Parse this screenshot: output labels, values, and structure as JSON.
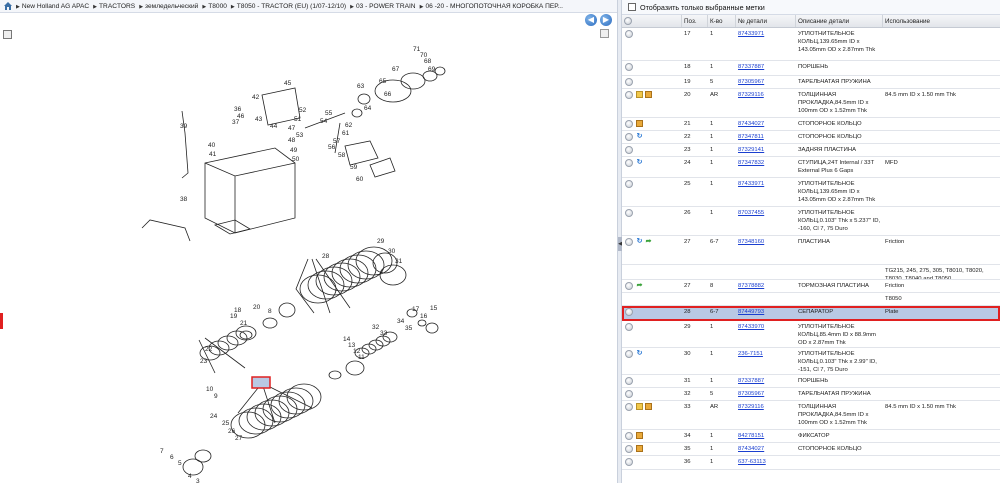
{
  "breadcrumb": [
    "New Holland AG APAC",
    "TRACTORS",
    "земледельческий",
    "T8000",
    "T8050 - TRACTOR (EU) (1/07-12/10)",
    "03 - POWER TRAIN",
    "06 -20 - МНОГОПОТОЧНАЯ КОРОБКА ПЕР..."
  ],
  "filter": {
    "label": "Отобразить только выбранные метки"
  },
  "columns": {
    "pos": "Поз.",
    "qty": "К-во",
    "num": "№ детали",
    "desc": "Описание детали",
    "use": "Использование"
  },
  "diagram_labels": [
    {
      "t": "39"
    },
    {
      "t": "40"
    },
    {
      "t": "41"
    },
    {
      "t": "42"
    },
    {
      "t": "43"
    },
    {
      "t": "44"
    },
    {
      "t": "45"
    },
    {
      "t": "46"
    },
    {
      "t": "47"
    },
    {
      "t": "48"
    },
    {
      "t": "49"
    },
    {
      "t": "50"
    },
    {
      "t": "51"
    },
    {
      "t": "52"
    },
    {
      "t": "53"
    },
    {
      "t": "54"
    },
    {
      "t": "55"
    },
    {
      "t": "56"
    },
    {
      "t": "57"
    },
    {
      "t": "58"
    },
    {
      "t": "59"
    },
    {
      "t": "60"
    },
    {
      "t": "61"
    },
    {
      "t": "62"
    },
    {
      "t": "63"
    },
    {
      "t": "64"
    },
    {
      "t": "65"
    },
    {
      "t": "66"
    },
    {
      "t": "67"
    },
    {
      "t": "68"
    },
    {
      "t": "69"
    },
    {
      "t": "70"
    },
    {
      "t": "71"
    },
    {
      "t": "36"
    },
    {
      "t": "37"
    },
    {
      "t": "38"
    },
    {
      "t": "18"
    },
    {
      "t": "19"
    },
    {
      "t": "20"
    },
    {
      "t": "21"
    },
    {
      "t": "22"
    },
    {
      "t": "23"
    },
    {
      "t": "24"
    },
    {
      "t": "25"
    },
    {
      "t": "26"
    },
    {
      "t": "27"
    },
    {
      "t": "28"
    },
    {
      "t": "29"
    },
    {
      "t": "30"
    },
    {
      "t": "31"
    },
    {
      "t": "32"
    },
    {
      "t": "33"
    },
    {
      "t": "34"
    },
    {
      "t": "35"
    },
    {
      "t": "17"
    },
    {
      "t": "16"
    },
    {
      "t": "15"
    },
    {
      "t": "14"
    },
    {
      "t": "13"
    },
    {
      "t": "12"
    },
    {
      "t": "11"
    },
    {
      "t": "10"
    },
    {
      "t": "9"
    },
    {
      "t": "8"
    },
    {
      "t": "7"
    },
    {
      "t": "6"
    },
    {
      "t": "5"
    },
    {
      "t": "4"
    },
    {
      "t": "3"
    },
    {
      "t": "2"
    },
    {
      "t": "1"
    }
  ],
  "parts": [
    {
      "icons": [
        "radio"
      ],
      "pos": "17",
      "qty": "1",
      "num": "87433971",
      "desc": "УПЛОТНИТЕЛЬНОЕ КОЛЬЦ,139.65mm ID x 143.05mm OD x 2.87mm Thk",
      "use": ""
    },
    {
      "icons": [
        "radio"
      ],
      "pos": "18",
      "qty": "1",
      "num": "87337887",
      "desc": "ПОРШЕНЬ",
      "use": ""
    },
    {
      "icons": [
        "radio"
      ],
      "pos": "19",
      "qty": "5",
      "num": "87305967",
      "desc": "ТАРЕЛЬЧАТАЯ ПРУЖИНА",
      "use": ""
    },
    {
      "icons": [
        "radio",
        "note",
        "box"
      ],
      "pos": "20",
      "qty": "AR",
      "num": "87329116",
      "desc": "ТОЛЩИННАЯ ПРОКЛАДКА,84.5mm ID x 100mm OD x 1.52mm Thk",
      "use": "84.5 mm ID x 1.50 mm Thk"
    },
    {
      "icons": [
        "radio",
        "box"
      ],
      "pos": "21",
      "qty": "1",
      "num": "87434027",
      "desc": "СТОПОРНОЕ КОЛЬЦО",
      "use": ""
    },
    {
      "icons": [
        "radio",
        "arrow"
      ],
      "pos": "22",
      "qty": "1",
      "num": "87347811",
      "desc": "СТОПОРНОЕ КОЛЬЦО",
      "use": ""
    },
    {
      "icons": [
        "radio"
      ],
      "pos": "23",
      "qty": "1",
      "num": "87329141",
      "desc": "ЗАДНЯЯ ПЛАСТИНА",
      "use": ""
    },
    {
      "icons": [
        "radio",
        "arrow"
      ],
      "pos": "24",
      "qty": "1",
      "num": "87347832",
      "desc": "СТУПИЦА,24T Internal / 33T External Plus 6 Gaps",
      "use": "MFD"
    },
    {
      "icons": [
        "radio"
      ],
      "pos": "25",
      "qty": "1",
      "num": "87433971",
      "desc": "УПЛОТНИТЕЛЬНОЕ КОЛЬЦ,139.65mm ID x 143.05mm OD x 2.87mm Thk",
      "use": ""
    },
    {
      "icons": [
        "radio"
      ],
      "pos": "26",
      "qty": "1",
      "num": "87037455",
      "desc": "УПЛОТНИТЕЛЬНОЕ КОЛЬЦ,0.103\" Thk x 5.237\" ID, -160, Cl 7, 75 Duro",
      "use": ""
    },
    {
      "icons": [
        "radio",
        "arrow",
        "green"
      ],
      "pos": "27",
      "qty": "6-7",
      "num": "87348160",
      "desc": "ПЛАСТИНА",
      "use": "Friction"
    },
    {
      "icons": [],
      "pos": "",
      "qty": "",
      "num": "",
      "desc": "",
      "use": "TG215, 245, 275, 305, T8010, T8020, T8030, T8040 and T8050"
    },
    {
      "icons": [
        "radio",
        "green"
      ],
      "pos": "27",
      "qty": "8",
      "num": "87378882",
      "desc": "ТОРМОЗНАЯ ПЛАСТИНА",
      "use": "Friction"
    },
    {
      "icons": [],
      "pos": "",
      "qty": "",
      "num": "",
      "desc": "",
      "use": "T8050"
    },
    {
      "icons": [
        "radio"
      ],
      "pos": "28",
      "qty": "6-7",
      "num": "87449793",
      "desc": "СЕПАРАТОР",
      "use": "Plate",
      "selected": true
    },
    {
      "icons": [
        "radio"
      ],
      "pos": "29",
      "qty": "1",
      "num": "87433970",
      "desc": "УПЛОТНИТЕЛЬНОЕ КОЛЬЦ,85.4mm ID x 88.9mm OD x 2.87mm Thk",
      "use": ""
    },
    {
      "icons": [
        "radio",
        "arrow"
      ],
      "pos": "30",
      "qty": "1",
      "num": "236-7151",
      "desc": "УПЛОТНИТЕЛЬНОЕ КОЛЬЦ,0.103\" Thk x 2.99\" ID, -151, Cl 7, 75 Duro",
      "use": ""
    },
    {
      "icons": [
        "radio"
      ],
      "pos": "31",
      "qty": "1",
      "num": "87337887",
      "desc": "ПОРШЕНЬ",
      "use": ""
    },
    {
      "icons": [
        "radio"
      ],
      "pos": "32",
      "qty": "5",
      "num": "87305967",
      "desc": "ТАРЕЛЬЧАТАЯ ПРУЖИНА",
      "use": ""
    },
    {
      "icons": [
        "radio",
        "note",
        "box"
      ],
      "pos": "33",
      "qty": "AR",
      "num": "87329116",
      "desc": "ТОЛЩИННАЯ ПРОКЛАДКА,84.5mm ID x 100mm OD x 1.52mm Thk",
      "use": "84.5 mm ID x 1.50 mm Thk"
    },
    {
      "icons": [
        "radio",
        "box"
      ],
      "pos": "34",
      "qty": "1",
      "num": "84278151",
      "desc": "ФИКСАТОР",
      "use": ""
    },
    {
      "icons": [
        "radio",
        "box"
      ],
      "pos": "35",
      "qty": "1",
      "num": "87434027",
      "desc": "СТОПОРНОЕ КОЛЬЦО",
      "use": ""
    },
    {
      "icons": [
        "radio"
      ],
      "pos": "36",
      "qty": "1",
      "num": "637-63113",
      "desc": "",
      "use": ""
    }
  ]
}
